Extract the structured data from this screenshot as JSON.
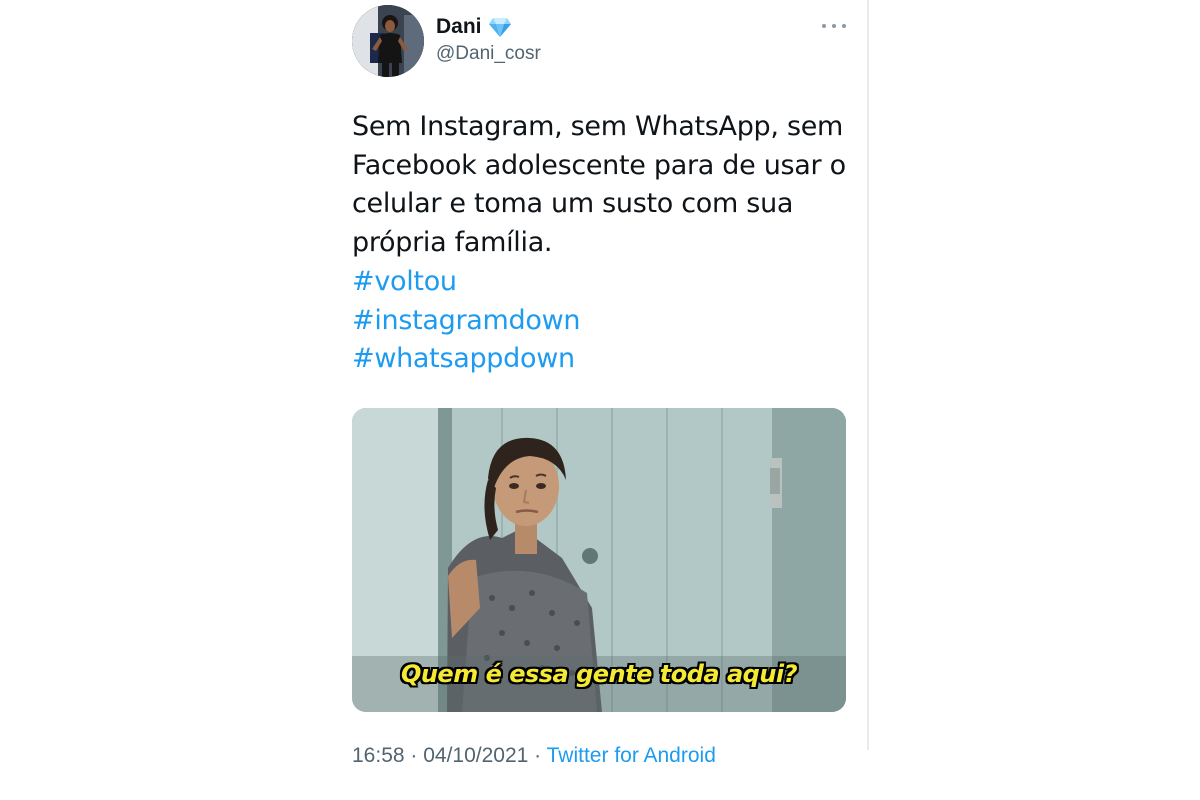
{
  "author": {
    "display_name": "Dani",
    "handle": "@Dani_cosr",
    "badge_icon": "diamond-icon"
  },
  "tweet": {
    "text": "Sem Instagram, sem WhatsApp, sem Facebook adolescente para de usar o celular e toma um susto com sua própria família.",
    "hashtags": [
      "#voltou",
      "#instagramdown",
      "#whatsappdown"
    ],
    "media_caption": "Quem é essa gente toda aqui?",
    "time": "16:58",
    "date": "04/10/2021",
    "separator": " · ",
    "source": "Twitter for Android"
  },
  "colors": {
    "link": "#1d9bf0",
    "secondary_text": "#536471",
    "caption": "#f4ea33"
  }
}
